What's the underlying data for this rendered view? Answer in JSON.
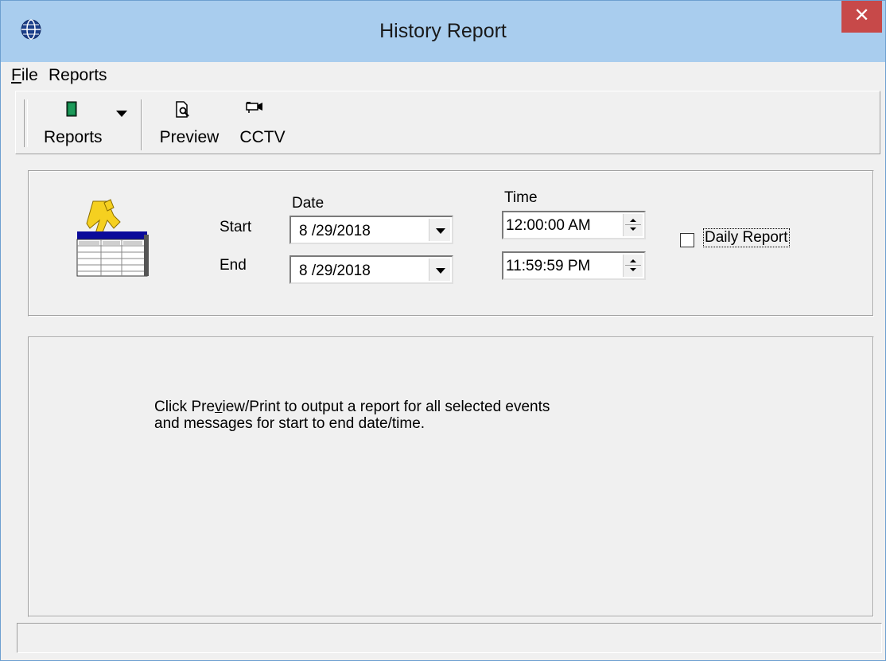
{
  "window": {
    "title": "History Report",
    "close_glyph": "✕"
  },
  "menubar": {
    "file_accel": "F",
    "file_rest": "ile",
    "reports": "Reports"
  },
  "toolbar": {
    "reports_label": "Reports",
    "preview_label": "Preview",
    "cctv_label": "CCTV"
  },
  "date_range": {
    "date_header": "Date",
    "time_header": "Time",
    "start_label": "Start",
    "end_label": "End",
    "start_date": "8 /29/2018",
    "end_date": "8 /29/2018",
    "start_time": "12:00:00 AM",
    "end_time": "11:59:59 PM",
    "daily_report_label": "Daily Report",
    "daily_report_checked": false
  },
  "message": {
    "line1_before": "Click Pre",
    "line1_accel": "v",
    "line1_after": "iew/Print to output a report for all selected events",
    "line2": "and messages for start to end date/time."
  },
  "icons": {
    "app": "globe-icon",
    "reports": "book-icon",
    "preview": "print-preview-icon",
    "cctv": "camera-icon",
    "history": "history-report-icon"
  },
  "colors": {
    "titlebar": "#a9cdee",
    "close_button": "#c74949",
    "window_bg": "#f0f0f0"
  }
}
